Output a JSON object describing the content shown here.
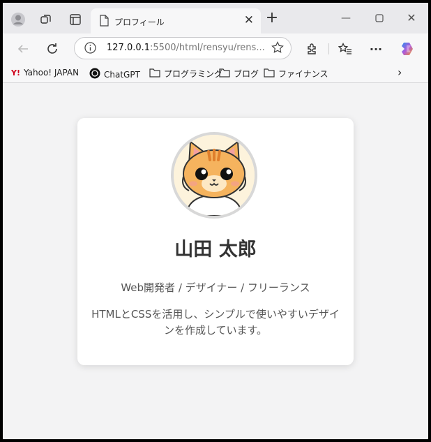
{
  "browser": {
    "tab_title": "プロフィール",
    "url_host": "127.0.0.1",
    "url_rest": ":5500/html/rensyu/rens...",
    "bookmarks": [
      {
        "label": "Yahoo! JAPAN",
        "icon": "yahoo-icon"
      },
      {
        "label": "ChatGPT",
        "icon": "chatgpt-icon"
      },
      {
        "label": "プログラミング",
        "icon": "folder-icon"
      },
      {
        "label": "ブログ",
        "icon": "folder-icon"
      },
      {
        "label": "ファイナンス",
        "icon": "folder-icon"
      }
    ]
  },
  "profile": {
    "name": "山田 太郎",
    "role": "Web開発者 / デザイナー / フリーランス",
    "bio": "HTMLとCSSを活用し、シンプルで使いやすいデザインを作成しています。"
  },
  "colors": {
    "page_bg": "#f3f3f4",
    "card_bg": "#ffffff",
    "cat_orange": "#f5b35e",
    "text_dark": "#333333"
  }
}
